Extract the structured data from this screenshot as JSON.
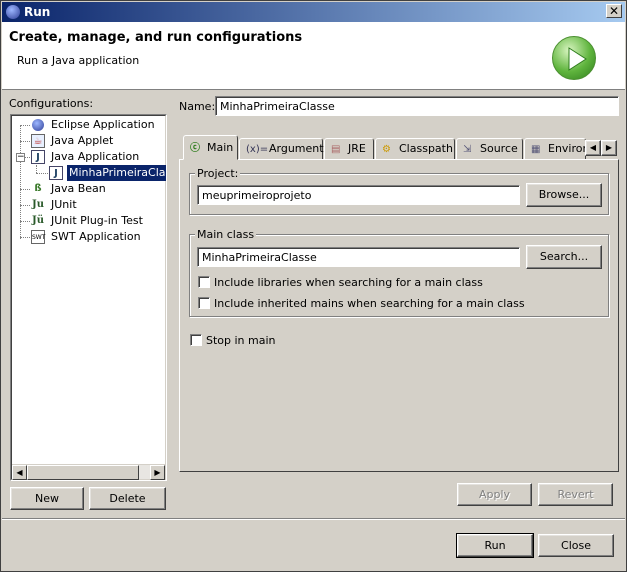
{
  "window": {
    "title": "Run",
    "close_glyph": "✕"
  },
  "header": {
    "title": "Create, manage, and run configurations",
    "subtitle": "Run a Java application",
    "icon": "run-play-icon"
  },
  "sidebar": {
    "label": "Configurations:",
    "items": [
      {
        "label": "Eclipse Application",
        "icon": "eclipse-icon"
      },
      {
        "label": "Java Applet",
        "icon": "applet-icon"
      },
      {
        "label": "Java Application",
        "icon": "java-app-icon",
        "expanded": true
      },
      {
        "label": "MinhaPrimeiraClasse",
        "icon": "java-config-icon",
        "selected": true
      },
      {
        "label": "Java Bean",
        "icon": "bean-icon"
      },
      {
        "label": "JUnit",
        "icon": "junit-icon"
      },
      {
        "label": "JUnit Plug-in Test",
        "icon": "junit-plugin-icon"
      },
      {
        "label": "SWT Application",
        "icon": "swt-icon"
      }
    ],
    "new_label": "New",
    "delete_label": "Delete"
  },
  "main": {
    "name_label": "Name:",
    "name_value": "MinhaPrimeiraClasse",
    "tabs": [
      {
        "label": "Main",
        "icon": "main-tab-icon",
        "active": true
      },
      {
        "label": "Arguments",
        "icon": "arguments-icon"
      },
      {
        "label": "JRE",
        "icon": "jre-icon"
      },
      {
        "label": "Classpath",
        "icon": "classpath-icon"
      },
      {
        "label": "Source",
        "icon": "source-icon"
      },
      {
        "label": "Environ",
        "icon": "environment-icon"
      }
    ],
    "project": {
      "group_label": "Project:",
      "value": "meuprimeiroprojeto",
      "browse_label": "Browse..."
    },
    "main_class": {
      "group_label": "Main class",
      "value": "MinhaPrimeiraClasse",
      "search_label": "Search...",
      "include_libraries_label": "Include libraries when searching for a main class",
      "include_inherited_label": "Include inherited mains when searching for a main class"
    },
    "stop_in_main_label": "Stop in main",
    "apply_label": "Apply",
    "revert_label": "Revert"
  },
  "footer": {
    "run_label": "Run",
    "close_label": "Close"
  }
}
